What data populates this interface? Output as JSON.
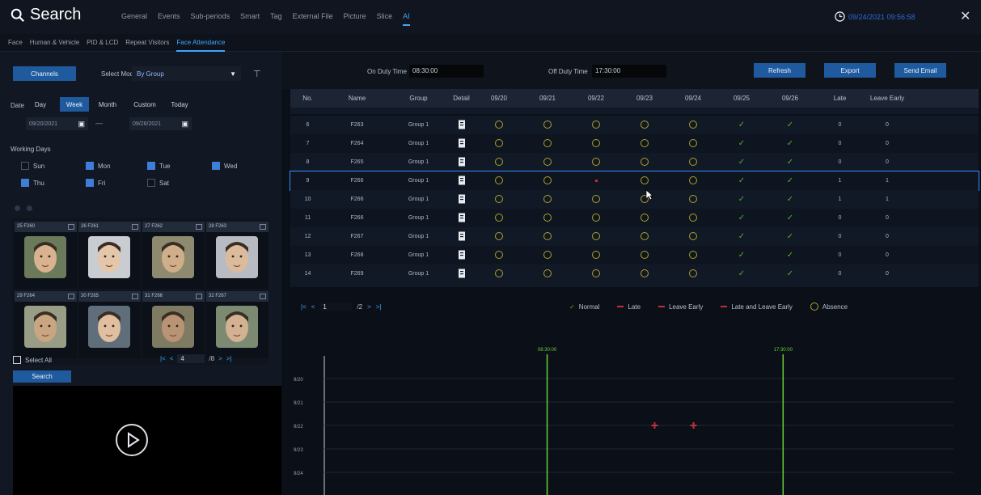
{
  "header": {
    "title": "Search",
    "tabs": [
      "General",
      "Events",
      "Sub-periods",
      "Smart",
      "Tag",
      "External File",
      "Picture",
      "Slice",
      "AI"
    ],
    "active_tab": "AI",
    "clock": "09/24/2021 09:56:58"
  },
  "subtabs": {
    "items": [
      "Face",
      "Human & Vehicle",
      "PID & LCD",
      "Repeat Visitors",
      "Face Attendance"
    ],
    "active": "Face Attendance"
  },
  "left": {
    "channels_label": "Channels",
    "select_mode_label": "Select Mode",
    "select_mode_value": "By Group",
    "date_label": "Date",
    "date_buttons": [
      "Day",
      "Week",
      "Month",
      "Custom",
      "Today"
    ],
    "date_active": "Week",
    "date_from": "09/20/2021",
    "date_to": "09/26/2021",
    "date_sep": "—",
    "working_days_label": "Working Days",
    "days": [
      {
        "label": "Sun",
        "checked": false
      },
      {
        "label": "Mon",
        "checked": true
      },
      {
        "label": "Tue",
        "checked": true
      },
      {
        "label": "Wed",
        "checked": true
      },
      {
        "label": "Thu",
        "checked": true
      },
      {
        "label": "Fri",
        "checked": true
      },
      {
        "label": "Sat",
        "checked": false
      }
    ],
    "faces": [
      {
        "label": "25 F260"
      },
      {
        "label": "26 F261"
      },
      {
        "label": "27 F262"
      },
      {
        "label": "28 F263"
      },
      {
        "label": "29 F264"
      },
      {
        "label": "30 F265"
      },
      {
        "label": "31 F266"
      },
      {
        "label": "32 F267"
      }
    ],
    "select_all_label": "Select All",
    "pager_page": "4",
    "pager_total": "/8",
    "search_label": "Search"
  },
  "toolbar": {
    "on_duty_label": "On Duty Time",
    "on_duty_value": "08:30:00",
    "off_duty_label": "Off Duty Time",
    "off_duty_value": "17:30:00",
    "refresh_label": "Refresh",
    "export_label": "Export",
    "send_email_label": "Send Email"
  },
  "table": {
    "headers": [
      "No.",
      "Name",
      "Group",
      "Detail",
      "09/20",
      "09/21",
      "09/22",
      "09/23",
      "09/24",
      "09/25",
      "09/26",
      "Late",
      "Leave Early"
    ],
    "rows": [
      {
        "no": "6",
        "name": "F263",
        "group": "Group 1",
        "days": [
          "a",
          "a",
          "a",
          "a",
          "a",
          "n",
          "n"
        ],
        "late": "0",
        "early": "0"
      },
      {
        "no": "7",
        "name": "F264",
        "group": "Group 1",
        "days": [
          "a",
          "a",
          "a",
          "a",
          "a",
          "n",
          "n"
        ],
        "late": "0",
        "early": "0"
      },
      {
        "no": "8",
        "name": "F265",
        "group": "Group 1",
        "days": [
          "a",
          "a",
          "a",
          "a",
          "a",
          "n",
          "n"
        ],
        "late": "0",
        "early": "0"
      },
      {
        "no": "9",
        "name": "F266",
        "group": "Group 1",
        "days": [
          "a",
          "a",
          "x",
          "a",
          "a",
          "n",
          "n"
        ],
        "late": "1",
        "early": "1"
      },
      {
        "no": "10",
        "name": "F266",
        "group": "Group 1",
        "days": [
          "a",
          "a",
          "a",
          "a",
          "a",
          "n",
          "n"
        ],
        "late": "1",
        "early": "1"
      },
      {
        "no": "11",
        "name": "F266",
        "group": "Group 1",
        "days": [
          "a",
          "a",
          "a",
          "a",
          "a",
          "n",
          "n"
        ],
        "late": "0",
        "early": "0"
      },
      {
        "no": "12",
        "name": "F267",
        "group": "Group 1",
        "days": [
          "a",
          "a",
          "a",
          "a",
          "a",
          "n",
          "n"
        ],
        "late": "0",
        "early": "0"
      },
      {
        "no": "13",
        "name": "F268",
        "group": "Group 1",
        "days": [
          "a",
          "a",
          "a",
          "a",
          "a",
          "n",
          "n"
        ],
        "late": "0",
        "early": "0"
      },
      {
        "no": "14",
        "name": "F269",
        "group": "Group 1",
        "days": [
          "a",
          "a",
          "a",
          "a",
          "a",
          "n",
          "n"
        ],
        "late": "0",
        "early": "0"
      }
    ],
    "pager_page": "1",
    "pager_total": "/2"
  },
  "legend": [
    {
      "label": "Normal",
      "symbol": "check",
      "color": "#49b22e"
    },
    {
      "label": "Late",
      "symbol": "square",
      "color": "#c0303a"
    },
    {
      "label": "Leave Early",
      "symbol": "square",
      "color": "#c0303a"
    },
    {
      "label": "Late and Leave Early",
      "symbol": "square",
      "color": "#c0303a"
    },
    {
      "label": "Absence",
      "symbol": "ring",
      "color": "#a9a326"
    }
  ],
  "chart_data": {
    "type": "scatter",
    "on_duty_marker": "08:30:00",
    "off_duty_marker": "17:30:00",
    "y_labels": [
      "9/20",
      "9/21",
      "9/22",
      "9/23",
      "9/24",
      "9/25"
    ],
    "points": [
      {
        "date": "9/22",
        "time": "12:36"
      },
      {
        "date": "9/22",
        "time": "14:05"
      }
    ]
  },
  "colors": {
    "accent": "#3fa6ff",
    "primary_button": "#1f5a9e",
    "selected_border": "#2f8fff",
    "marker_line": "#64d23a",
    "absence": "#a9a326",
    "normal": "#49b22e",
    "late": "#c0303a"
  }
}
